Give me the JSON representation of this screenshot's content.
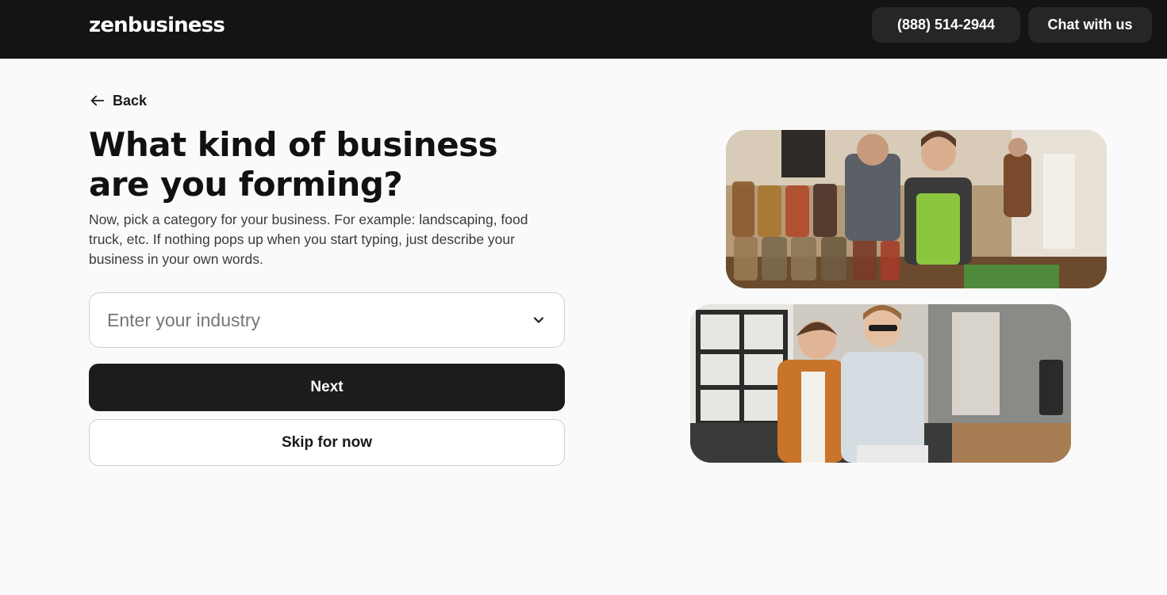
{
  "header": {
    "logo_text": "zenbusiness",
    "phone_label": "(888) 514-2944",
    "chat_label": "Chat with us"
  },
  "nav": {
    "back_label": "Back"
  },
  "form": {
    "title_line1": "What kind of business",
    "title_line2": "are you forming?",
    "subtitle": "Now, pick a category for your business. For example: landscaping, food truck, etc. If nothing pops up when you start typing, just describe your business in your own words.",
    "industry_placeholder": "Enter your industry",
    "next_label": "Next",
    "skip_label": "Skip for now"
  },
  "images": {
    "photo_1": "shop-owners-photo",
    "photo_2": "cafe-workers-photo"
  },
  "colors": {
    "header_bg": "#141414",
    "primary_button": "#1c1c1c",
    "page_bg": "#fafafa"
  }
}
